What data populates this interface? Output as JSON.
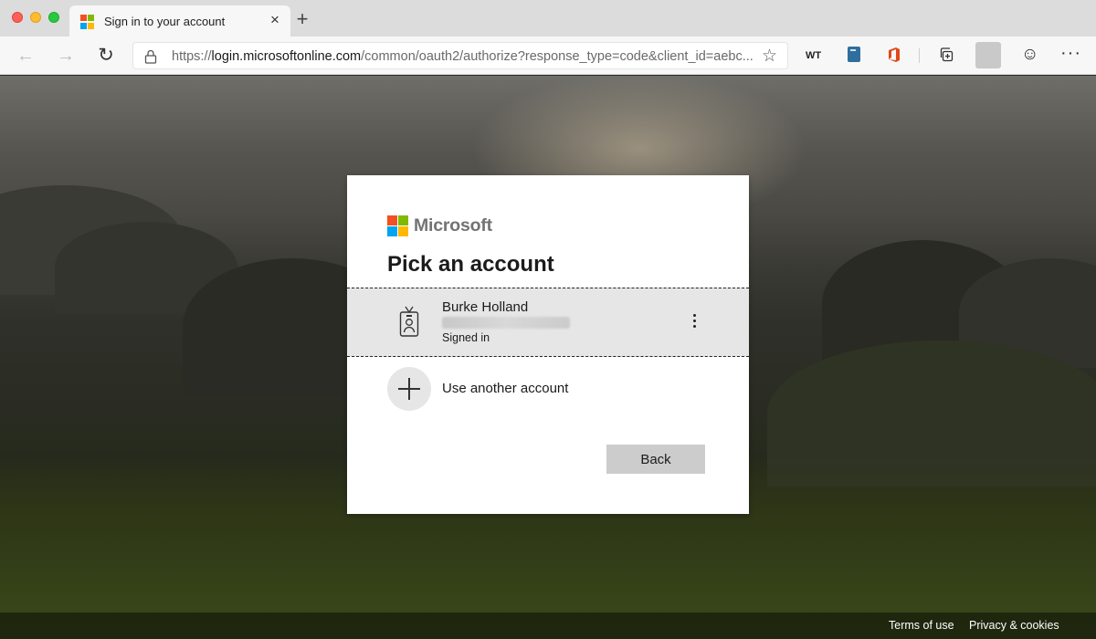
{
  "browser": {
    "tab_title": "Sign in to your account",
    "tab_close": "×",
    "new_tab": "+",
    "url_protocol": "https://",
    "url_host": "login.microsoftonline.com",
    "url_path": "/common/oauth2/authorize?response_type=code&client_id=aebc...",
    "extensions": {
      "wt_label": "WT"
    },
    "icons": [
      "back-icon",
      "forward-icon",
      "refresh-icon",
      "lock-icon",
      "star-icon",
      "book-icon",
      "office-icon",
      "collections-icon",
      "emoji-icon",
      "more-icon"
    ]
  },
  "brand": {
    "wordmark": "Microsoft",
    "colors": [
      "#f25022",
      "#7fba00",
      "#00a4ef",
      "#ffb900"
    ]
  },
  "dialog": {
    "title": "Pick an account",
    "account": {
      "name": "Burke Holland",
      "status": "Signed in"
    },
    "add_account_label": "Use another account",
    "back_label": "Back"
  },
  "footer": {
    "terms": "Terms of use",
    "privacy": "Privacy & cookies"
  }
}
